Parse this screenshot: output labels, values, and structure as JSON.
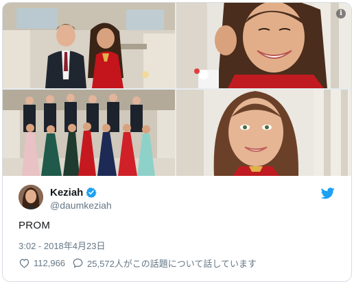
{
  "tweet": {
    "display_name": "Keziah",
    "handle": "@daumkeziah",
    "text": "PROM",
    "timestamp": "3:02 - 2018年4月23日",
    "likes": "112,966",
    "discussion": "25,572人がこの話題について話しています",
    "info_badge": "i"
  },
  "icons": {
    "info": "info-icon",
    "verified": "verified-badge-icon",
    "platform": "twitter-bird-icon",
    "like": "heart-icon",
    "reply": "speech-bubble-icon"
  },
  "colors": {
    "brand": "#1da1f2",
    "text": "#14171a",
    "muted": "#657786",
    "border": "#d6dde3"
  }
}
